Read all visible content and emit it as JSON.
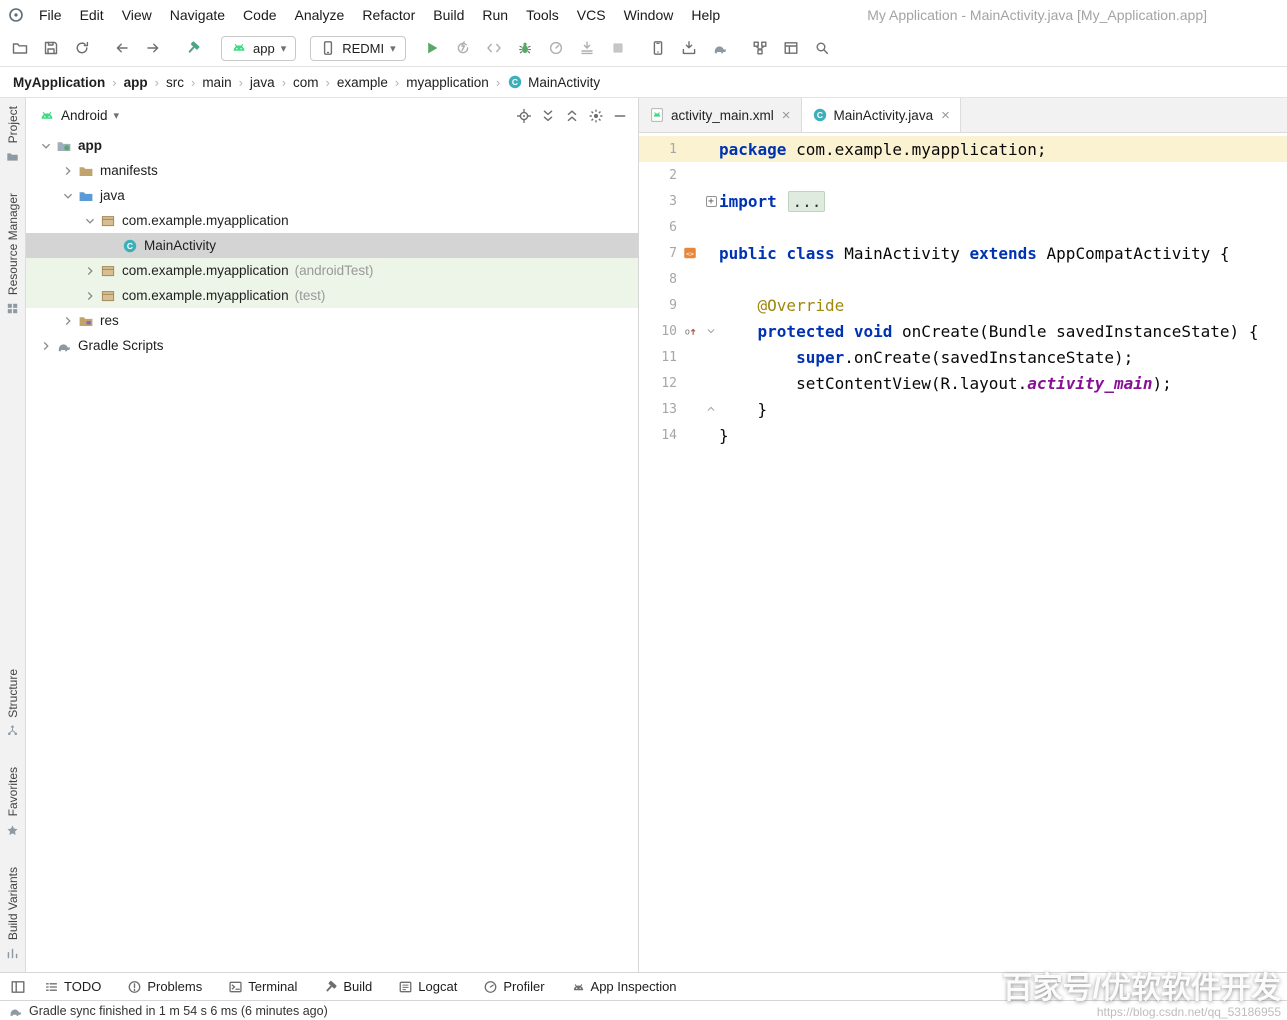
{
  "window": {
    "title": "My Application - MainActivity.java [My_Application.app]"
  },
  "menubar": {
    "items": [
      "File",
      "Edit",
      "View",
      "Navigate",
      "Code",
      "Analyze",
      "Refactor",
      "Build",
      "Run",
      "Tools",
      "VCS",
      "Window",
      "Help"
    ]
  },
  "toolbar": {
    "items": [
      {
        "type": "group",
        "icons": [
          "open",
          "save",
          "sync"
        ]
      },
      {
        "type": "group",
        "icons": [
          "back",
          "forward"
        ]
      },
      {
        "type": "group",
        "icons": [
          "build-hammer"
        ]
      },
      {
        "type": "dropdown",
        "name": "run-config",
        "label": "app",
        "icon": "android-head"
      },
      {
        "type": "dropdown",
        "name": "device",
        "label": "REDMI",
        "icon": "phone"
      },
      {
        "type": "group",
        "icons": [
          "run",
          "apply-changes",
          "apply-code-changes",
          "debug",
          "profile",
          "attach-debugger",
          "stop"
        ]
      },
      {
        "type": "group",
        "icons": [
          "avd-manager",
          "sdk-manager",
          "gradle-sync"
        ]
      },
      {
        "type": "group",
        "icons": [
          "project-structure",
          "layout-inspector",
          "search-everywhere"
        ]
      }
    ]
  },
  "breadcrumbs": [
    {
      "label": "MyApplication",
      "bold": true
    },
    {
      "label": "app",
      "bold": true
    },
    {
      "label": "src"
    },
    {
      "label": "main"
    },
    {
      "label": "java"
    },
    {
      "label": "com"
    },
    {
      "label": "example"
    },
    {
      "label": "myapplication"
    },
    {
      "label": "MainActivity",
      "icon": "class"
    }
  ],
  "left_stripe": {
    "top": [
      {
        "label": "Project",
        "icon": "project-stripe"
      },
      {
        "label": "Resource Manager",
        "icon": "resource-manager-stripe"
      }
    ],
    "bottom": [
      {
        "label": "Structure",
        "icon": "structure-stripe"
      },
      {
        "label": "Favorites",
        "icon": "favorites-stripe"
      },
      {
        "label": "Build Variants",
        "icon": "build-variants-stripe"
      }
    ]
  },
  "project_panel": {
    "title": "Android",
    "header_icons": [
      "locate",
      "expand-all",
      "collapse-all",
      "settings-gear",
      "hide"
    ],
    "tree": [
      {
        "indent": 1,
        "arrow": "open",
        "icon": "app-folder",
        "label": "app",
        "bold": true
      },
      {
        "indent": 2,
        "arrow": "closed",
        "icon": "folder",
        "label": "manifests"
      },
      {
        "indent": 2,
        "arrow": "open",
        "icon": "java-folder",
        "label": "java"
      },
      {
        "indent": 3,
        "arrow": "open",
        "icon": "package",
        "label": "com.example.myapplication"
      },
      {
        "indent": 4,
        "arrow": "none",
        "icon": "class",
        "label": "MainActivity",
        "selected": true
      },
      {
        "indent": 3,
        "arrow": "closed",
        "icon": "package",
        "label": "com.example.myapplication",
        "suffix": "(androidTest)",
        "test": true
      },
      {
        "indent": 3,
        "arrow": "closed",
        "icon": "package",
        "label": "com.example.myapplication",
        "suffix": "(test)",
        "test": true
      },
      {
        "indent": 2,
        "arrow": "closed",
        "icon": "res-folder",
        "label": "res"
      },
      {
        "indent": 1,
        "arrow": "closed",
        "icon": "gradle",
        "label": "Gradle Scripts"
      }
    ]
  },
  "editor": {
    "tabs": [
      {
        "label": "activity_main.xml",
        "icon": "android-file"
      },
      {
        "label": "MainActivity.java",
        "icon": "class",
        "active": true
      }
    ],
    "code_lines": [
      {
        "num": "1",
        "caret": true,
        "segs": [
          [
            "kw",
            "package"
          ],
          [
            "pl",
            " com.example.myapplication;"
          ]
        ]
      },
      {
        "num": "2",
        "segs": []
      },
      {
        "num": "3",
        "fold": "plus",
        "segs": [
          [
            "kw",
            "import"
          ],
          [
            "pl",
            " "
          ],
          [
            "folded",
            "..."
          ]
        ]
      },
      {
        "num": "6",
        "segs": []
      },
      {
        "num": "7",
        "g": "android",
        "segs": [
          [
            "kw",
            "public"
          ],
          [
            "pl",
            " "
          ],
          [
            "kw",
            "class"
          ],
          [
            "pl",
            " MainActivity "
          ],
          [
            "kw",
            "extends"
          ],
          [
            "pl",
            " AppCompatActivity {"
          ]
        ]
      },
      {
        "num": "8",
        "segs": []
      },
      {
        "num": "9",
        "segs": [
          [
            "pl",
            "    "
          ],
          [
            "anno",
            "@Override"
          ]
        ]
      },
      {
        "num": "10",
        "g": "override",
        "fold": "open",
        "segs": [
          [
            "pl",
            "    "
          ],
          [
            "kw",
            "protected"
          ],
          [
            "pl",
            " "
          ],
          [
            "kw",
            "void"
          ],
          [
            "pl",
            " onCreate(Bundle savedInstanceState) {"
          ]
        ]
      },
      {
        "num": "11",
        "segs": [
          [
            "pl",
            "        "
          ],
          [
            "kw",
            "super"
          ],
          [
            "pl",
            ".onCreate(savedInstanceState);"
          ]
        ]
      },
      {
        "num": "12",
        "segs": [
          [
            "pl",
            "        setContentView(R.layout."
          ],
          [
            "field",
            "activity_main"
          ],
          [
            "pl",
            ");"
          ]
        ]
      },
      {
        "num": "13",
        "fold": "end",
        "segs": [
          [
            "pl",
            "    }"
          ]
        ]
      },
      {
        "num": "14",
        "segs": [
          [
            "pl",
            "}"
          ]
        ]
      }
    ]
  },
  "bottom_bar": {
    "items": [
      {
        "label": "TODO",
        "icon": "todo"
      },
      {
        "label": "Problems",
        "icon": "problems"
      },
      {
        "label": "Terminal",
        "icon": "terminal"
      },
      {
        "label": "Build",
        "icon": "build-gray"
      },
      {
        "label": "Logcat",
        "icon": "logcat"
      },
      {
        "label": "Profiler",
        "icon": "profiler"
      },
      {
        "label": "App Inspection",
        "icon": "app-inspection"
      }
    ]
  },
  "status_bar": {
    "text": "Gradle sync finished in 1 m 54 s 6 ms (6 minutes ago)"
  },
  "watermark": {
    "line1": "百家号/优软软件开发",
    "line2": "https://blog.csdn.net/qq_53186955"
  }
}
